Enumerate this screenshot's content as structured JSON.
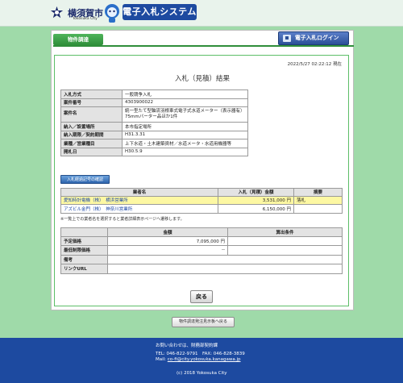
{
  "header": {
    "city_name": "横須賀市",
    "city_sub": "Yokosuka City",
    "system_title": "電子入札システム"
  },
  "topbar": {
    "tab_label": "物件調達",
    "login_button": "電子入札ログイン"
  },
  "content": {
    "timestamp": "2022/5/27 02:22:12 現在",
    "heading": "入札（見積）結果",
    "info": [
      {
        "label": "入札方式",
        "value": "一般競争入札"
      },
      {
        "label": "案件番号",
        "value": "4303900022"
      },
      {
        "label": "案件名",
        "value": "統一型たて型軸流羽根車式電子式水道メーター（表示器有）75mmバーター品ほか1件"
      },
      {
        "label": "納入／設置場所",
        "value": "本市指定場所"
      },
      {
        "label": "納入期限／契約期間",
        "value": "H31.3.31"
      },
      {
        "label": "業種／営業種目",
        "value": "上下水道・土木建築資材／水道メータ・水道用機器等"
      },
      {
        "label": "開札日",
        "value": "H30.5.9"
      }
    ],
    "history_button": "入札経過記号の確認",
    "results": {
      "headers": [
        "業者名",
        "入札（見積）金額",
        "摘要"
      ],
      "rows": [
        {
          "name": "愛知時計電機（株）　横浜営業所",
          "amount": "3,531,000 円",
          "note": "落札",
          "winner": true
        },
        {
          "name": "アズビル金門（株）　神奈川営業所",
          "amount": "6,150,000 円",
          "note": "",
          "winner": false
        }
      ]
    },
    "note": "※一覧上での業者名を選択すると業者詳細表示ページへ遷移します。",
    "prices": {
      "headers": [
        "金額",
        "算出条件"
      ],
      "rows": [
        {
          "label": "予定価格",
          "amount": "7,095,000 円",
          "condition": ""
        },
        {
          "label": "最低制限価格",
          "amount": "--",
          "condition": ""
        },
        {
          "label": "備考",
          "amount": "",
          "condition": ""
        },
        {
          "label": "リンクURL",
          "amount": "",
          "condition": ""
        }
      ]
    },
    "back_button": "戻る"
  },
  "list_button": "物件調達発注見示板へ戻る",
  "footer": {
    "contact": "お問い合わせは、財務部契約課",
    "tel_fax": "TEL: 046-822-9791　FAX: 046-828-3839",
    "mail_label": "Mail:",
    "mail": "co-fi@city.yokosuka.kanagawa.jp",
    "copyright": "(c) 2018 Yokosuka City"
  },
  "colors": {
    "background": "#9fdaa9",
    "accent_green": "#2f8e3a",
    "brand_blue": "#1d4aa0",
    "winner_row": "#fdf8a3"
  }
}
